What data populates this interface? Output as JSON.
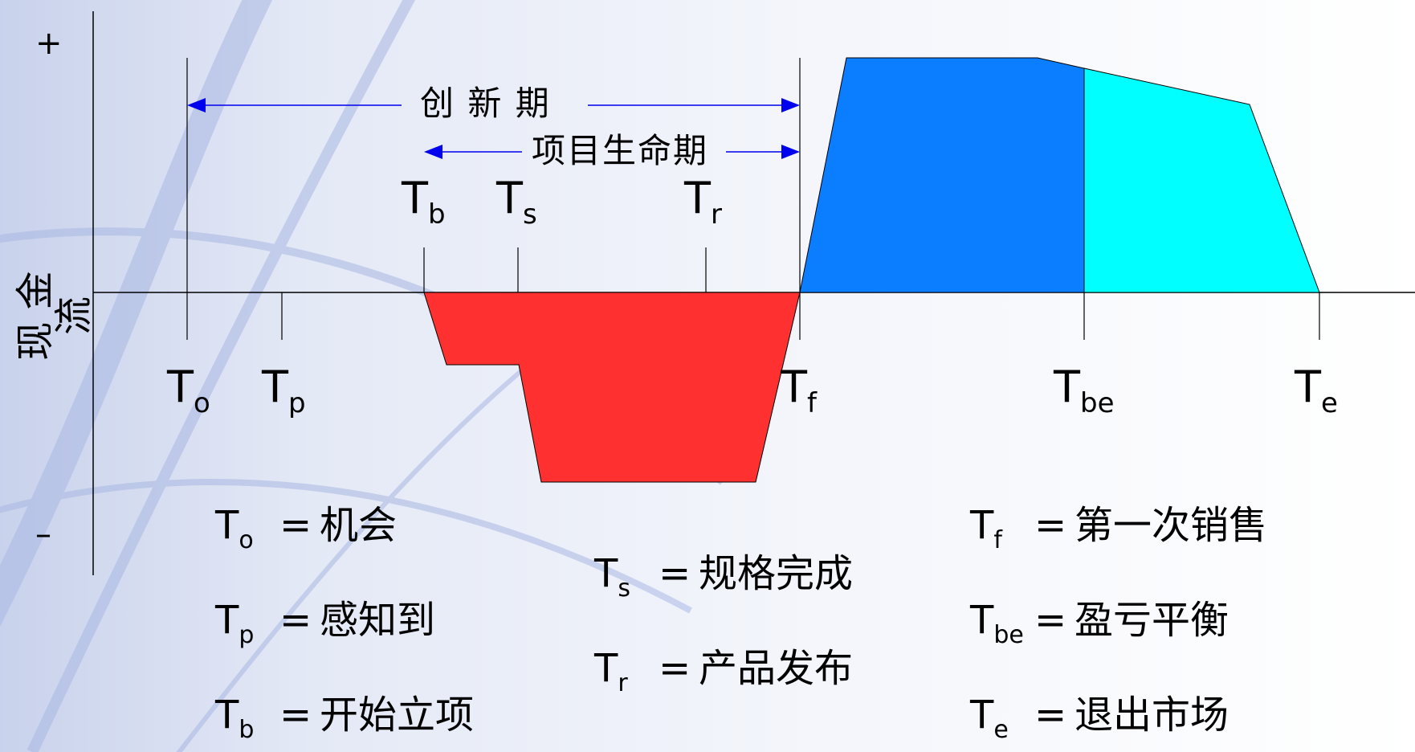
{
  "axis": {
    "y_label": "现 金 流",
    "plus": "+",
    "minus": "–"
  },
  "arrows": {
    "innovation": "创 新 期",
    "project_life": "项目生命期"
  },
  "milestones": {
    "to": {
      "main": "T",
      "sub": "o"
    },
    "tp": {
      "main": "T",
      "sub": "p"
    },
    "tb": {
      "main": "T",
      "sub": "b"
    },
    "ts": {
      "main": "T",
      "sub": "s"
    },
    "tr": {
      "main": "T",
      "sub": "r"
    },
    "tf": {
      "main": "T",
      "sub": "f"
    },
    "tbe": {
      "main": "T",
      "sub": "be"
    },
    "te": {
      "main": "T",
      "sub": "e"
    }
  },
  "legend": [
    {
      "main": "T",
      "sub": "o",
      "eq": "=",
      "text": "机会"
    },
    {
      "main": "T",
      "sub": "p",
      "eq": "=",
      "text": "感知到"
    },
    {
      "main": "T",
      "sub": "b",
      "eq": "=",
      "text": "开始立项"
    },
    {
      "main": "T",
      "sub": "s",
      "eq": "=",
      "text": "规格完成"
    },
    {
      "main": "T",
      "sub": "r",
      "eq": "=",
      "text": "产品发布"
    },
    {
      "main": "T",
      "sub": "f",
      "eq": "=",
      "text": "第一次销售"
    },
    {
      "main": "T",
      "sub": "be",
      "eq": "=",
      "text": "盈亏平衡"
    },
    {
      "main": "T",
      "sub": "e",
      "eq": "=",
      "text": "退出市场"
    }
  ],
  "colors": {
    "investment": "#ff3030",
    "revenue": "#0b7dff",
    "profit": "#00ffff",
    "arrow": "#0000ee"
  }
}
